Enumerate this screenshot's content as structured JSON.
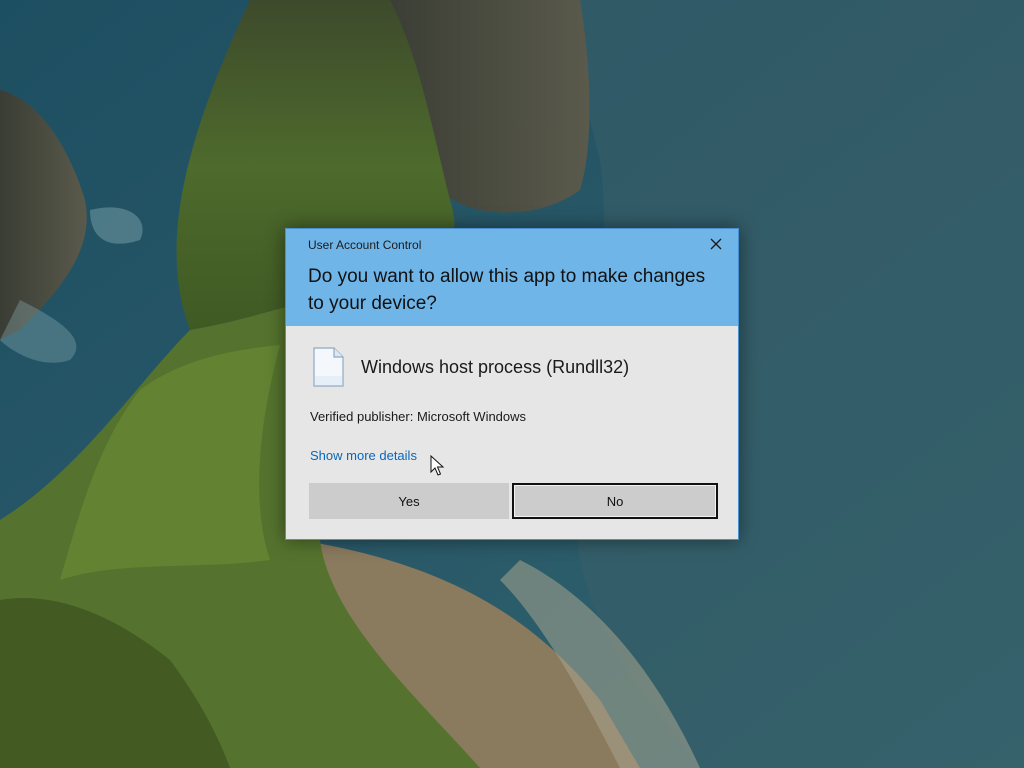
{
  "dialog": {
    "title": "User Account Control",
    "question": "Do you want to allow this app to make changes to your device?",
    "app_name": "Windows host process (Rundll32)",
    "publisher": "Verified publisher: Microsoft Windows",
    "details_link": "Show more details",
    "yes_label": "Yes",
    "no_label": "No",
    "close_icon": "close-icon",
    "app_icon": "file-icon"
  },
  "colors": {
    "header": "#6fb5e8",
    "body": "#e6e6e6",
    "link": "#0a67b8",
    "button": "#cccccc"
  }
}
